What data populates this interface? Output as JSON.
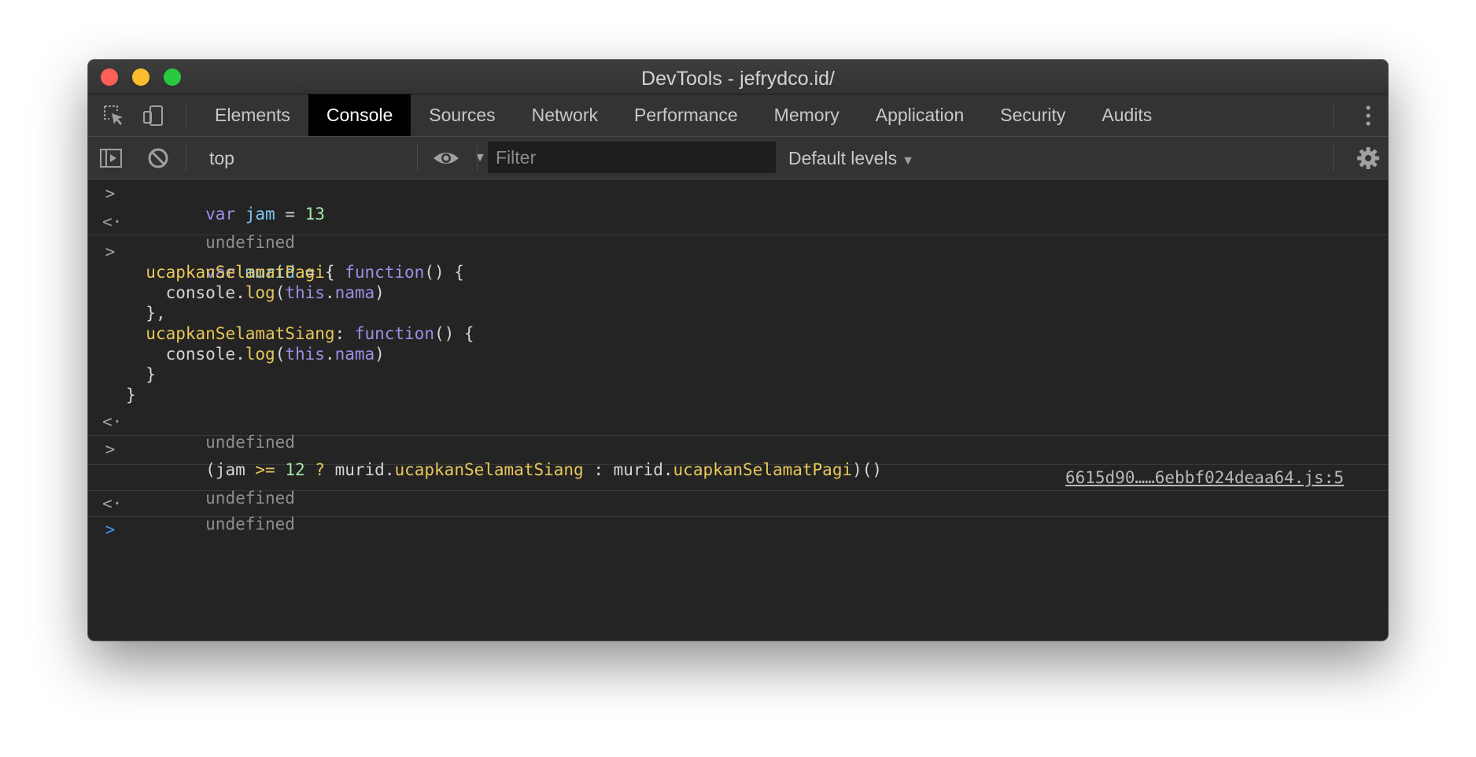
{
  "window": {
    "title": "DevTools - jefrydco.id/"
  },
  "tabs": [
    {
      "label": "Elements",
      "active": false
    },
    {
      "label": "Console",
      "active": true
    },
    {
      "label": "Sources",
      "active": false
    },
    {
      "label": "Network",
      "active": false
    },
    {
      "label": "Performance",
      "active": false
    },
    {
      "label": "Memory",
      "active": false
    },
    {
      "label": "Application",
      "active": false
    },
    {
      "label": "Security",
      "active": false
    },
    {
      "label": "Audits",
      "active": false
    }
  ],
  "toolbar": {
    "context": "top",
    "filter_placeholder": "Filter",
    "filter_value": "",
    "levels": "Default levels"
  },
  "console": {
    "entry1": {
      "kw": "var",
      "name": "jam",
      "op": " = ",
      "value": "13"
    },
    "result1": "undefined",
    "entry2": {
      "kw": "var",
      "name": "murid",
      "open": " = {",
      "method1": "ucapkanSelamatPagi",
      "method2": "ucapkanSelamatSiang",
      "colon": ": ",
      "fn_kw": "function",
      "fn_sig": "() {",
      "obj": "console",
      "dot": ".",
      "call": "log",
      "paren_open": "(",
      "this_kw": "this",
      "prop": "nama",
      "paren_close": ")",
      "close_method": "},",
      "close_method_last": "}",
      "close_obj": "}"
    },
    "result2": "undefined",
    "entry3": {
      "open": "(jam ",
      "op": ">=",
      "num": "12",
      "q": "?",
      "obj1": "murid",
      "method_a": "ucapkanSelamatSiang",
      "colon": ":",
      "obj2": "murid",
      "method_b": "ucapkanSelamatPagi",
      "tail": ")()"
    },
    "log_output": "undefined",
    "log_source": "6615d90……6ebbf024deaa64.js:5",
    "result3": "undefined"
  },
  "colors": {
    "keyword": "#9c8fe6",
    "variable": "#7ec6f0",
    "number": "#a8e6a8",
    "property": "#e8c85a",
    "prompt_active": "#4d8ef0"
  }
}
